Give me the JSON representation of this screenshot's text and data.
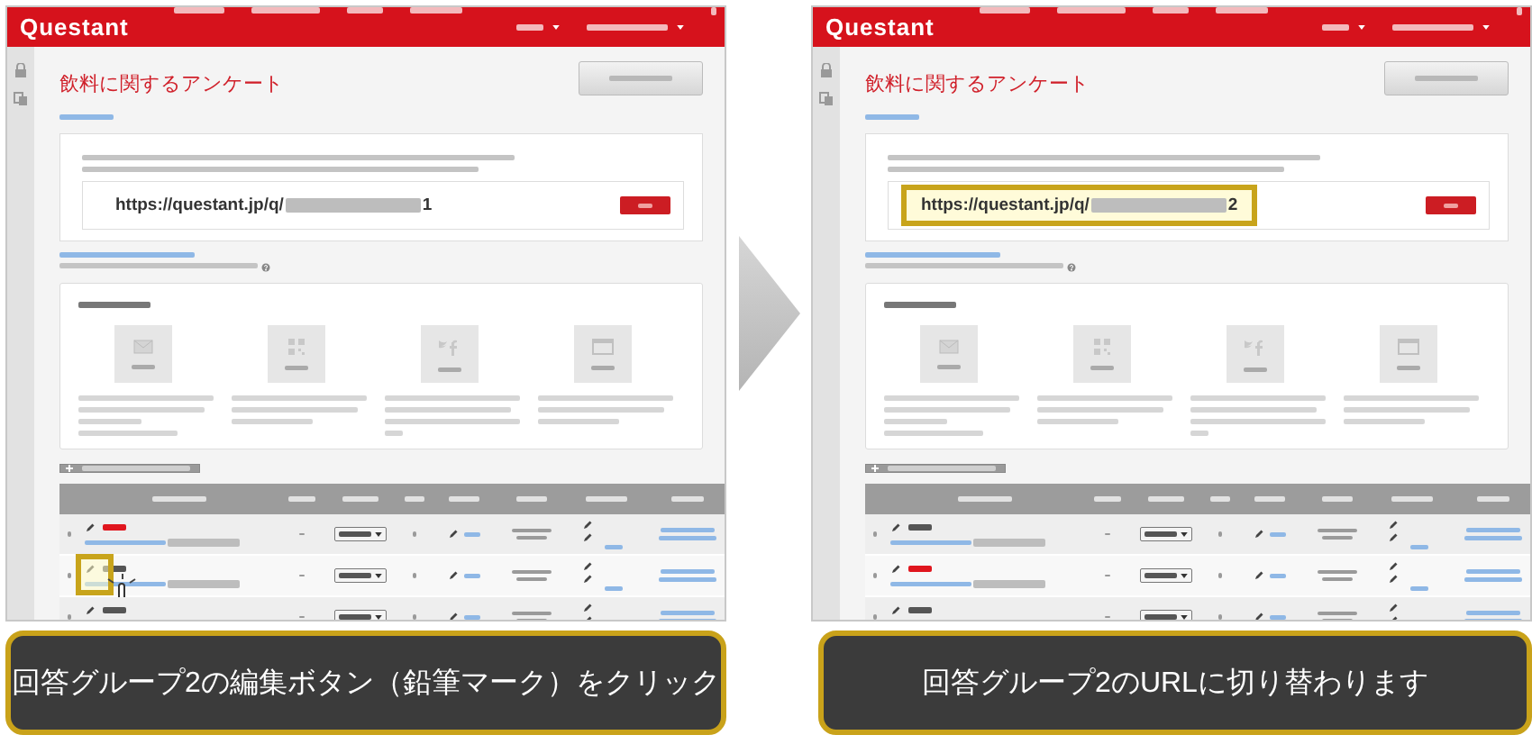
{
  "panels": [
    {
      "logo": "Questant",
      "title": "飲料に関するアンケート",
      "url": {
        "text": "https://questant.jp/q/",
        "suffix": "1",
        "highlighted": false
      },
      "methods": [
        {
          "kind": "mail"
        },
        {
          "kind": "qr"
        },
        {
          "kind": "sns"
        },
        {
          "kind": "web"
        }
      ],
      "rows": [
        {
          "selected": true,
          "highlighted": false,
          "pointer": false
        },
        {
          "selected": false,
          "highlighted": true,
          "pointer": true
        },
        {
          "selected": false,
          "highlighted": false,
          "pointer": false
        }
      ]
    },
    {
      "logo": "Questant",
      "title": "飲料に関するアンケート",
      "url": {
        "text": "https://questant.jp/q/",
        "suffix": "2",
        "highlighted": true
      },
      "methods": [
        {
          "kind": "mail"
        },
        {
          "kind": "qr"
        },
        {
          "kind": "sns"
        },
        {
          "kind": "web"
        }
      ],
      "rows": [
        {
          "selected": false,
          "highlighted": false,
          "pointer": false
        },
        {
          "selected": true,
          "highlighted": false,
          "pointer": false
        },
        {
          "selected": false,
          "highlighted": false,
          "pointer": false
        }
      ]
    }
  ],
  "captions": [
    "回答グループ2の編集ボタン（鉛筆マーク）をクリック",
    "回答グループ2のURLに切り替わります"
  ]
}
